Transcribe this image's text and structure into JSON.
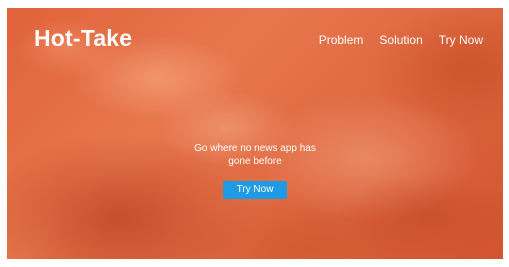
{
  "brand": {
    "logo_text": "Hot-Take"
  },
  "nav": {
    "items": [
      {
        "label": "Problem"
      },
      {
        "label": "Solution"
      },
      {
        "label": "Try Now"
      }
    ]
  },
  "hero": {
    "headline": "Go where no news app has gone before",
    "cta_label": "Try Now"
  },
  "colors": {
    "background_accent": "#e0623a",
    "cta_button": "#1f9be6",
    "text": "#ffffff"
  }
}
